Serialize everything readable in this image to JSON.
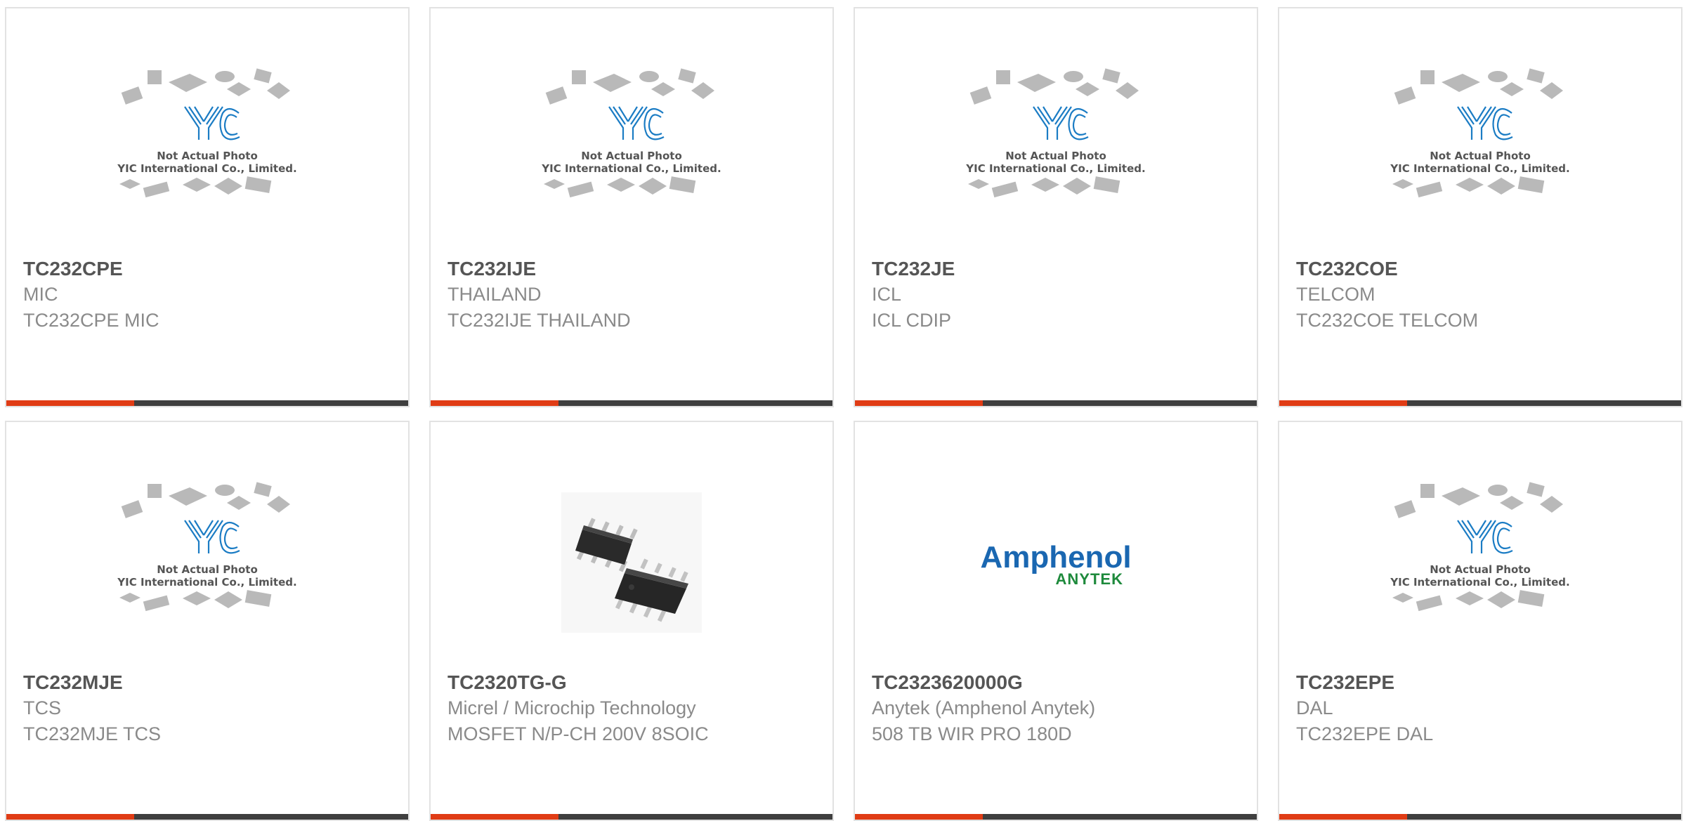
{
  "placeholder_photo": {
    "line1": "Not Actual Photo",
    "line2": "YIC International Co., Limited.",
    "logo_text": "YIC"
  },
  "products": [
    {
      "part_number": "TC232CPE",
      "manufacturer": "MIC",
      "description": "TC232CPE MIC",
      "image": "yic-placeholder"
    },
    {
      "part_number": "TC232IJE",
      "manufacturer": "THAILAND",
      "description": "TC232IJE THAILAND",
      "image": "yic-placeholder"
    },
    {
      "part_number": "TC232JE",
      "manufacturer": "ICL",
      "description": "ICL CDIP",
      "image": "yic-placeholder"
    },
    {
      "part_number": "TC232COE",
      "manufacturer": "TELCOM",
      "description": "TC232COE TELCOM",
      "image": "yic-placeholder"
    },
    {
      "part_number": "TC232MJE",
      "manufacturer": "TCS",
      "description": "TC232MJE TCS",
      "image": "yic-placeholder"
    },
    {
      "part_number": "TC2320TG-G",
      "manufacturer": "Micrel / Microchip Technology",
      "description": "MOSFET N/P-CH 200V 8SOIC",
      "image": "soic-8-chip-photo"
    },
    {
      "part_number": "TC2323620000G",
      "manufacturer": "Anytek (Amphenol Anytek)",
      "description": "508 TB WIR PRO 180D",
      "image": "amphenol-anytek-logo"
    },
    {
      "part_number": "TC232EPE",
      "manufacturer": "DAL",
      "description": "TC232EPE DAL",
      "image": "yic-placeholder"
    }
  ],
  "amphenol_logo": {
    "brand": "Amphenol",
    "sub": "ANYTEK"
  },
  "colors": {
    "accent": "#e03c15",
    "bar": "#3f3f3f",
    "border": "#e2e2e2",
    "yic_blue": "#1b7cc4",
    "amphenol_blue": "#1a67b1",
    "anytek_green": "#1e8a3c"
  }
}
